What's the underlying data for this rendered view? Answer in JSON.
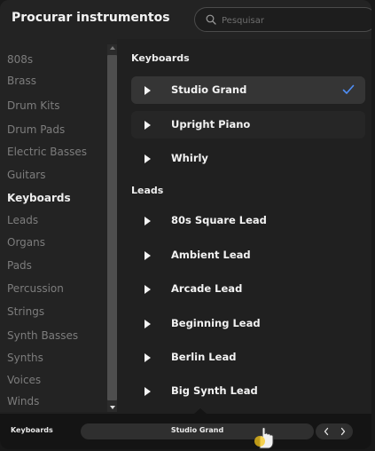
{
  "header": {
    "title": "Procurar instrumentos",
    "search_placeholder": "Pesquisar"
  },
  "sidebar": {
    "categories": [
      {
        "label": "808s"
      },
      {
        "label": "Brass"
      },
      {
        "label": "Drum Kits"
      },
      {
        "label": "Drum Pads"
      },
      {
        "label": "Electric Basses"
      },
      {
        "label": "Guitars"
      },
      {
        "label": "Keyboards",
        "active": true
      },
      {
        "label": "Leads"
      },
      {
        "label": "Organs"
      },
      {
        "label": "Pads"
      },
      {
        "label": "Percussion"
      },
      {
        "label": "Strings"
      },
      {
        "label": "Synth Basses"
      },
      {
        "label": "Synths"
      },
      {
        "label": "Voices"
      },
      {
        "label": "Winds"
      }
    ]
  },
  "list": {
    "sections": [
      {
        "title": "Keyboards",
        "items": [
          {
            "label": "Studio Grand",
            "selected": true
          },
          {
            "label": "Upright Piano"
          },
          {
            "label": "Whirly"
          }
        ]
      },
      {
        "title": "Leads",
        "items": [
          {
            "label": "80s Square Lead"
          },
          {
            "label": "Ambient Lead"
          },
          {
            "label": "Arcade Lead"
          },
          {
            "label": "Beginning Lead"
          },
          {
            "label": "Berlin Lead"
          },
          {
            "label": "Big Synth Lead"
          }
        ]
      }
    ]
  },
  "bottom_bar": {
    "category": "Keyboards",
    "current_instrument": "Studio Grand",
    "prev_icon": "chevron-left-icon",
    "next_icon": "chevron-right-icon"
  },
  "colors": {
    "accent": "#4f8ff7",
    "panel_bg": "#202020",
    "selected_row_bg": "#353535"
  }
}
